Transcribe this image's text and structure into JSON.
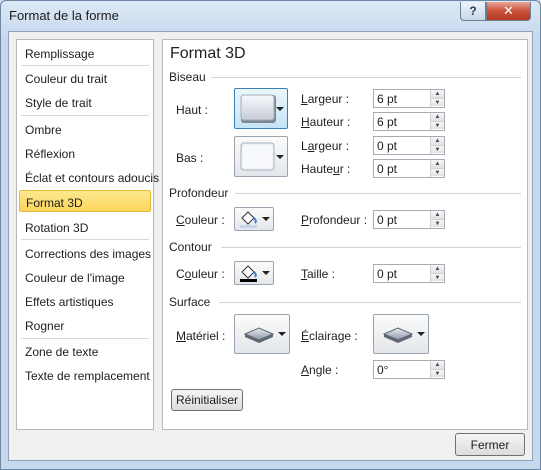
{
  "window": {
    "title": "Format de la forme",
    "help_glyph": "?",
    "close_glyph": "✕"
  },
  "nav": {
    "items": [
      {
        "label": "Remplissage"
      },
      {
        "label": "Couleur du trait"
      },
      {
        "label": "Style de trait"
      },
      {
        "label": "Ombre"
      },
      {
        "label": "Réflexion"
      },
      {
        "label": "Éclat et contours adoucis"
      },
      {
        "label": "Format 3D",
        "selected": true
      },
      {
        "label": "Rotation 3D"
      },
      {
        "label": "Corrections des images"
      },
      {
        "label": "Couleur de l'image"
      },
      {
        "label": "Effets artistiques"
      },
      {
        "label": "Rogner"
      },
      {
        "label": "Zone de texte"
      },
      {
        "label": "Texte de remplacement"
      }
    ]
  },
  "panel": {
    "title": "Format 3D",
    "biseau": {
      "heading": "Biseau",
      "haut_label": "Haut :",
      "bas_label": "Bas :",
      "haut_largeur_label": "Largeur :",
      "haut_largeur_value": "6 pt",
      "haut_hauteur_label": "Hauteur :",
      "haut_hauteur_value": "6 pt",
      "bas_largeur_label": "Largeur :",
      "bas_largeur_value": "0 pt",
      "bas_hauteur_label": "Hauteur :",
      "bas_hauteur_value": "0 pt"
    },
    "profondeur": {
      "heading": "Profondeur",
      "couleur_label": "Couleur :",
      "profondeur_label": "Profondeur :",
      "profondeur_value": "0 pt"
    },
    "contour": {
      "heading": "Contour",
      "couleur_label": "Couleur :",
      "taille_label": "Taille :",
      "taille_value": "0 pt"
    },
    "surface": {
      "heading": "Surface",
      "materiel_label": "Matériel :",
      "eclairage_label": "Éclairage :",
      "angle_label": "Angle :",
      "angle_value": "0°"
    },
    "reset_label": "Réinitialiser"
  },
  "footer": {
    "close_label": "Fermer"
  },
  "colors": {
    "selected_bg": "#fcd55b",
    "contour_color": "#000000"
  }
}
